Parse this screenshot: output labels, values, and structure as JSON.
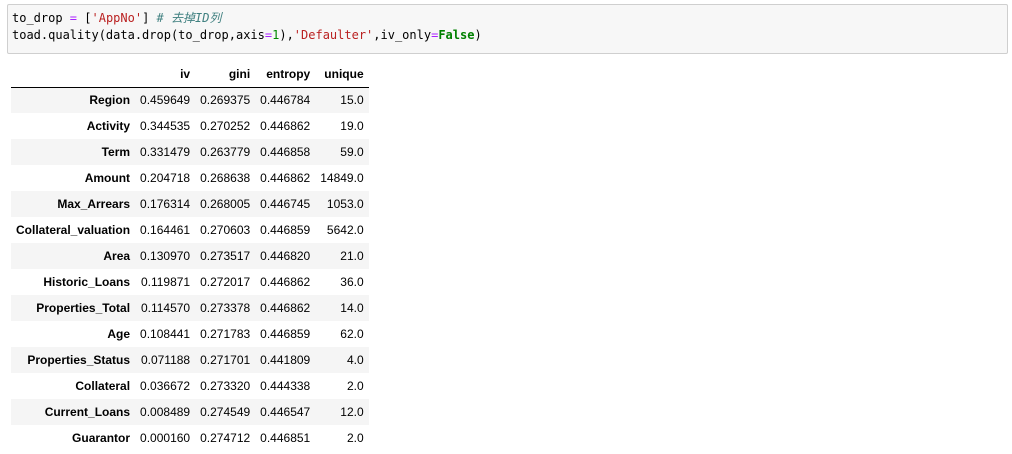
{
  "code_cell": {
    "line1": {
      "var": "to_drop",
      "assign": " = ",
      "open_bracket": "[",
      "string": "'AppNo'",
      "close_bracket": "]",
      "comment": " # 去掉ID列"
    },
    "line2": {
      "call_prefix": "toad.quality(data.drop(to_drop,axis",
      "eq1": "=",
      "num": "1",
      "mid": "),",
      "string": "'Defaulter'",
      "mid2": ",iv_only",
      "eq2": "=",
      "keyword": "False",
      "end": ")"
    }
  },
  "table": {
    "columns": [
      "",
      "iv",
      "gini",
      "entropy",
      "unique"
    ],
    "rows": [
      {
        "index": "Region",
        "iv": "0.459649",
        "gini": "0.269375",
        "entropy": "0.446784",
        "unique": "15.0"
      },
      {
        "index": "Activity",
        "iv": "0.344535",
        "gini": "0.270252",
        "entropy": "0.446862",
        "unique": "19.0"
      },
      {
        "index": "Term",
        "iv": "0.331479",
        "gini": "0.263779",
        "entropy": "0.446858",
        "unique": "59.0"
      },
      {
        "index": "Amount",
        "iv": "0.204718",
        "gini": "0.268638",
        "entropy": "0.446862",
        "unique": "14849.0"
      },
      {
        "index": "Max_Arrears",
        "iv": "0.176314",
        "gini": "0.268005",
        "entropy": "0.446745",
        "unique": "1053.0"
      },
      {
        "index": "Collateral_valuation",
        "iv": "0.164461",
        "gini": "0.270603",
        "entropy": "0.446859",
        "unique": "5642.0"
      },
      {
        "index": "Area",
        "iv": "0.130970",
        "gini": "0.273517",
        "entropy": "0.446820",
        "unique": "21.0"
      },
      {
        "index": "Historic_Loans",
        "iv": "0.119871",
        "gini": "0.272017",
        "entropy": "0.446862",
        "unique": "36.0"
      },
      {
        "index": "Properties_Total",
        "iv": "0.114570",
        "gini": "0.273378",
        "entropy": "0.446862",
        "unique": "14.0"
      },
      {
        "index": "Age",
        "iv": "0.108441",
        "gini": "0.271783",
        "entropy": "0.446859",
        "unique": "62.0"
      },
      {
        "index": "Properties_Status",
        "iv": "0.071188",
        "gini": "0.271701",
        "entropy": "0.441809",
        "unique": "4.0"
      },
      {
        "index": "Collateral",
        "iv": "0.036672",
        "gini": "0.273320",
        "entropy": "0.444338",
        "unique": "2.0"
      },
      {
        "index": "Current_Loans",
        "iv": "0.008489",
        "gini": "0.274549",
        "entropy": "0.446547",
        "unique": "12.0"
      },
      {
        "index": "Guarantor",
        "iv": "0.000160",
        "gini": "0.274712",
        "entropy": "0.446851",
        "unique": "2.0"
      }
    ]
  }
}
